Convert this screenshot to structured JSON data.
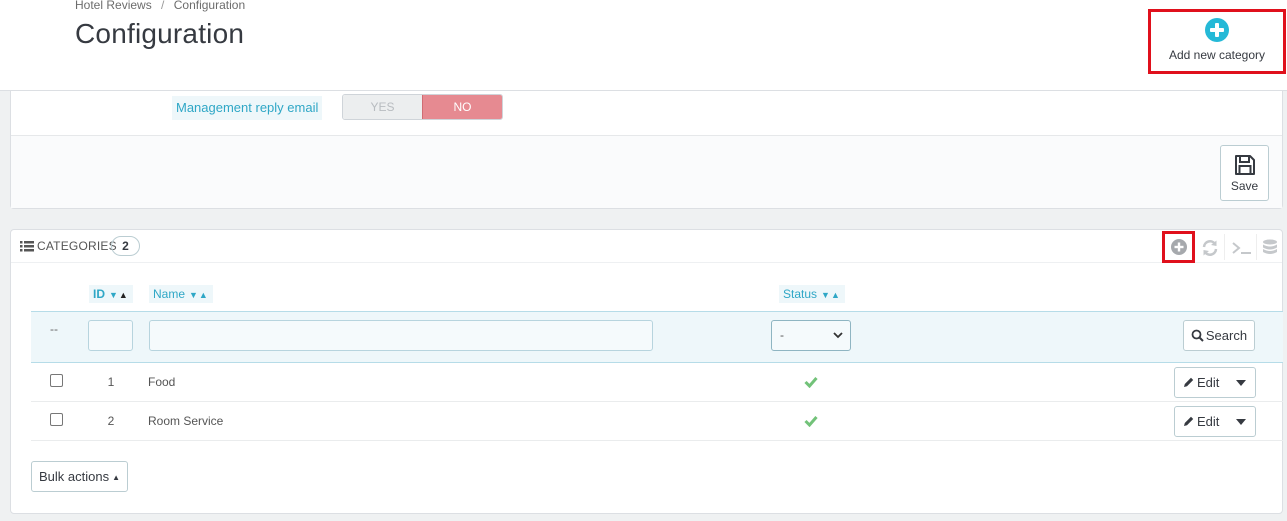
{
  "breadcrumb": {
    "parent": "Hotel Reviews",
    "separator": "/",
    "current": "Configuration"
  },
  "page": {
    "title": "Configuration"
  },
  "toolbar": {
    "add_category_label": "Add new category",
    "add_icon": "plus-circle-icon"
  },
  "settings": {
    "management_reply_email": {
      "label": "Management reply email",
      "yes_label": "YES",
      "no_label": "NO",
      "selected": "NO"
    },
    "save_label": "Save"
  },
  "categories_panel": {
    "title": "CATEGORIES",
    "count": "2",
    "columns": {
      "id": "ID",
      "name": "Name",
      "status": "Status"
    },
    "filter": {
      "placeholder_dashes": "--",
      "status_option": "-",
      "search_label": "Search"
    },
    "rows": [
      {
        "id": "1",
        "name": "Food",
        "status": "enabled",
        "edit_label": "Edit"
      },
      {
        "id": "2",
        "name": "Room Service",
        "status": "enabled",
        "edit_label": "Edit"
      }
    ],
    "bulk_label": "Bulk actions"
  },
  "colors": {
    "accent": "#25b9d7",
    "highlight_border": "#e0101c",
    "status_ok": "#72c279",
    "switch_no": "#e68a91"
  }
}
